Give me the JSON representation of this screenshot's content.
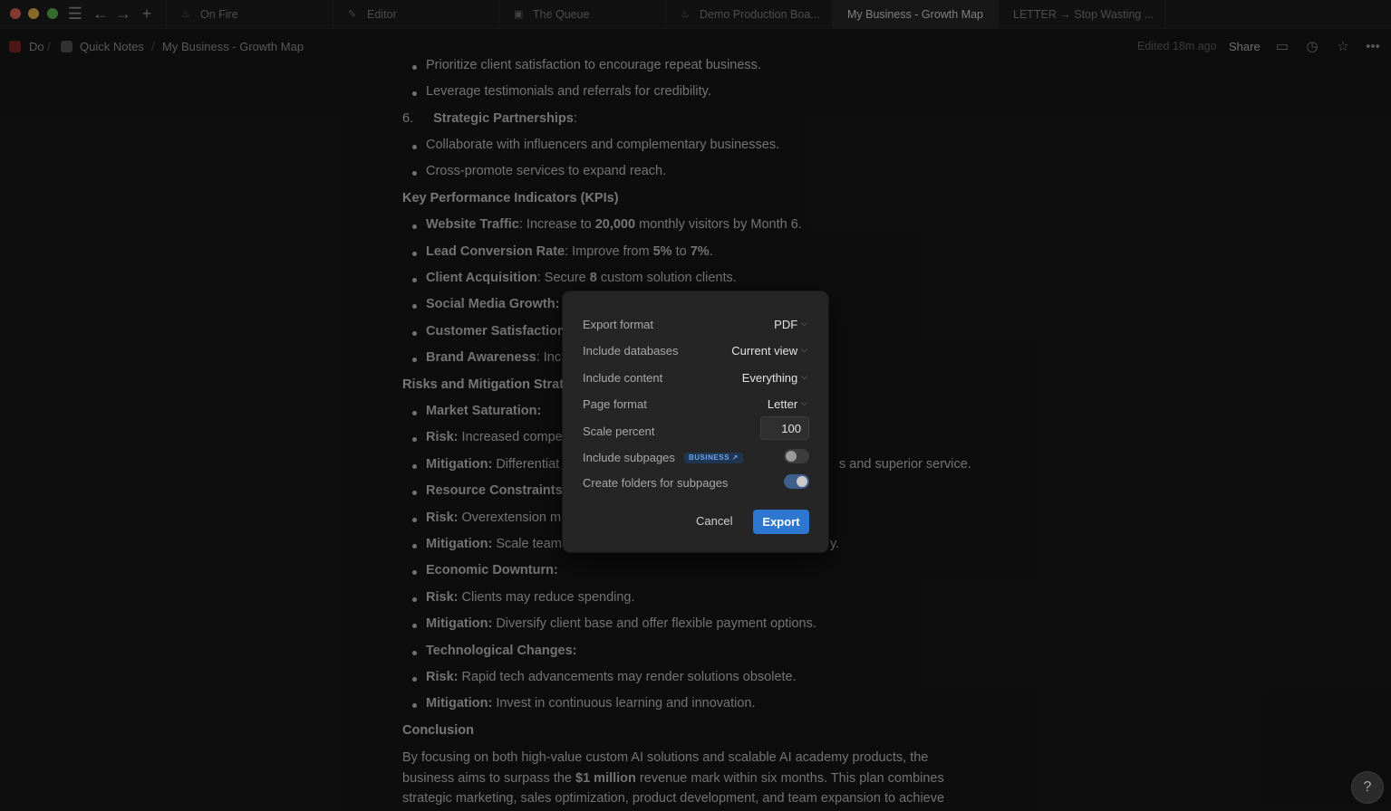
{
  "tabs": [
    {
      "label": "On Fire",
      "icon": "flame-icon",
      "active": false
    },
    {
      "label": "Editor",
      "icon": "pencil-icon",
      "active": false
    },
    {
      "label": "The Queue",
      "icon": "queue-icon",
      "active": false
    },
    {
      "label": "Demo Production Boa...",
      "icon": "flame-icon",
      "active": false
    },
    {
      "label": "My Business - Growth Map",
      "icon": "",
      "active": true
    },
    {
      "label": "LETTER → Stop Wasting ...",
      "icon": "",
      "active": false
    }
  ],
  "breadcrumb": {
    "items": [
      "Do",
      "Quick Notes",
      "My Business - Growth Map"
    ],
    "edited": "Edited 18m ago",
    "share": "Share"
  },
  "doc": {
    "lines": {
      "l1": "Prioritize client satisfaction to encourage repeat business.",
      "l2": "Leverage testimonials and referrals for credibility.",
      "l3_num": "6.",
      "l3": "Strategic Partnerships",
      "l3_colon": ":",
      "l4": "Collaborate with influencers and complementary businesses.",
      "l5": "Cross-promote services to expand reach.",
      "h_kpi": "Key Performance Indicators (KPIs)",
      "k1_b": "Website Traffic",
      "k1_t": ": Increase to ",
      "k1_b2": "20,000",
      "k1_t2": " monthly visitors by Month 6.",
      "k2_b": "Lead Conversion Rate",
      "k2_t": ": Improve from ",
      "k2_b2": "5%",
      "k2_t2": " to ",
      "k2_b3": "7%",
      "k2_t3": ".",
      "k3_b": "Client Acquisition",
      "k3_t": ": Secure ",
      "k3_b2": "8",
      "k3_t2": " custom solution clients.",
      "k4_b": "Social Media Growth:",
      "k5_b": "Customer Satisfaction",
      "k6_b": "Brand Awareness",
      "k6_t": ": Inc",
      "h_risk": "Risks and Mitigation Strat",
      "r1_b": "Market Saturation:",
      "r2_b": "Risk:",
      "r2_t": " Increased compe",
      "r3_b": "Mitigation:",
      "r3_t": " Differentiat",
      "r3_tail": "s and superior service.",
      "r4_b": "Resource Constraints",
      "r5_b": "Risk:",
      "r5_t": " Overextension m",
      "r6_b": "Mitigation:",
      "r6_t": " Scale team",
      "r6_tail": "y.",
      "r7_b": "Economic Downturn:",
      "r8_b": "Risk:",
      "r8_t": " Clients may reduce spending.",
      "r9_b": "Mitigation:",
      "r9_t": " Diversify client base and offer flexible payment options.",
      "r10_b": "Technological Changes:",
      "r11_b": "Risk:",
      "r11_t": " Rapid tech advancements may render solutions obsolete.",
      "r12_b": "Mitigation:",
      "r12_t": " Invest in continuous learning and innovation.",
      "h_conc": "Conclusion",
      "c1a": "By focusing on both high-value custom AI solutions and scalable AI academy products, the",
      "c2a": "business aims to surpass the ",
      "c2b": "$1 million",
      "c2c": " revenue mark within six months. This plan combines",
      "c3a": "strategic marketing, sales optimization, product development, and team expansion to achieve"
    }
  },
  "export_dialog": {
    "export_format": {
      "label": "Export format",
      "value": "PDF"
    },
    "include_databases": {
      "label": "Include databases",
      "value": "Current view"
    },
    "include_content": {
      "label": "Include content",
      "value": "Everything"
    },
    "page_format": {
      "label": "Page format",
      "value": "Letter"
    },
    "scale_percent": {
      "label": "Scale percent",
      "value": "100"
    },
    "include_subpages": {
      "label": "Include subpages",
      "badge": "BUSINESS ↗",
      "enabled": false
    },
    "create_folders": {
      "label": "Create folders for subpages",
      "enabled": true
    },
    "cancel_label": "Cancel",
    "export_label": "Export"
  },
  "colors": {
    "accent": "#2e77d0",
    "background": "#191919"
  }
}
